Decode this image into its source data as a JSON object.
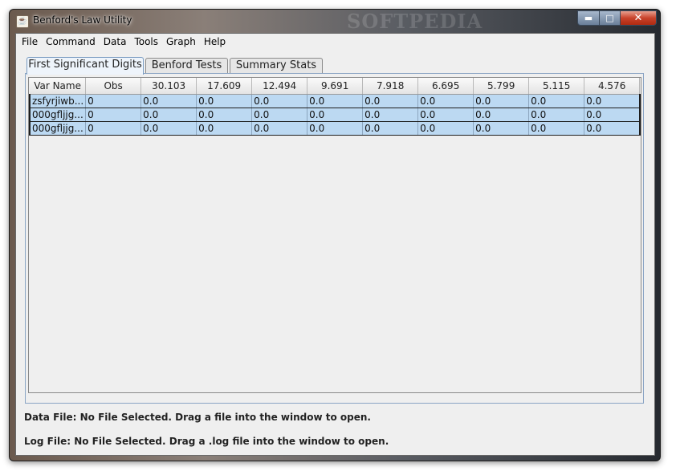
{
  "window": {
    "title": "Benford's Law Utility",
    "watermark": "SOFTPEDIA"
  },
  "caption_buttons": {
    "minimize_icon": "minimize-icon",
    "maximize_icon": "maximize-icon",
    "close_icon": "close-icon"
  },
  "menu": [
    "File",
    "Command",
    "Data",
    "Tools",
    "Graph",
    "Help"
  ],
  "tabs": [
    "First Significant Digits",
    "Benford Tests",
    "Summary Stats"
  ],
  "active_tab": "First Significant Digits",
  "table": {
    "columns": [
      "Var Name",
      "Obs",
      "30.103",
      "17.609",
      "12.494",
      "9.691",
      "7.918",
      "6.695",
      "5.799",
      "5.115",
      "4.576"
    ],
    "rows": [
      [
        "zsfyrjiwb...",
        "0",
        "0.0",
        "0.0",
        "0.0",
        "0.0",
        "0.0",
        "0.0",
        "0.0",
        "0.0",
        "0.0"
      ],
      [
        "000gfljjg...",
        "0",
        "0.0",
        "0.0",
        "0.0",
        "0.0",
        "0.0",
        "0.0",
        "0.0",
        "0.0",
        "0.0"
      ],
      [
        "000gfljjg...",
        "0",
        "0.0",
        "0.0",
        "0.0",
        "0.0",
        "0.0",
        "0.0",
        "0.0",
        "0.0",
        "0.0"
      ]
    ]
  },
  "status": {
    "data_file": "Data File: No File Selected.  Drag a file into the window to open.",
    "log_file": "Log File: No File Selected.  Drag a .log file into the window to open."
  },
  "colors": {
    "selection": "#bcd9f2",
    "tab_active_border": "#7a9cc2",
    "close_button": "#c8432b"
  }
}
